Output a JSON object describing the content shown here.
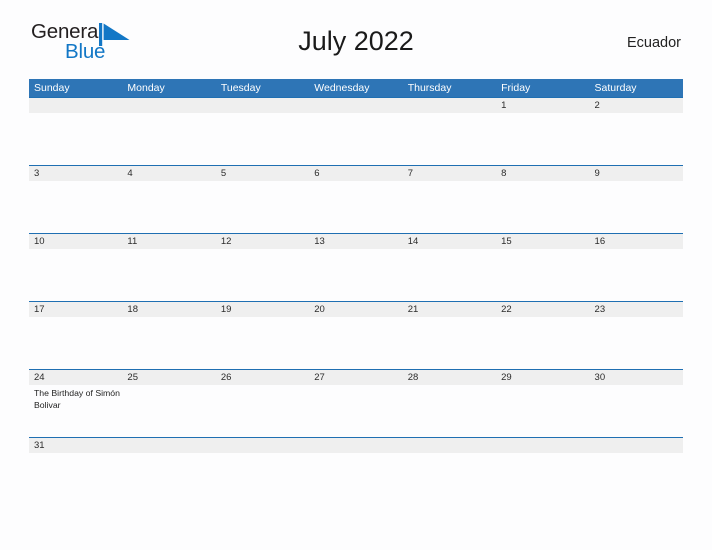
{
  "brand": {
    "name_part1": "General",
    "name_part2": "Blue",
    "flag_color": "#1277c6",
    "text_color": "#231f20"
  },
  "header": {
    "title": "July 2022",
    "locale": "Ecuador"
  },
  "theme": {
    "header_blue": "#2e75b6",
    "rule_blue": "#1f6fb2",
    "band_gray": "#efefef",
    "page_background": "#fdfdfe"
  },
  "calendar": {
    "weekdays": [
      "Sunday",
      "Monday",
      "Tuesday",
      "Wednesday",
      "Thursday",
      "Friday",
      "Saturday"
    ],
    "weeks": [
      {
        "days": [
          {
            "num": "",
            "event": ""
          },
          {
            "num": "",
            "event": ""
          },
          {
            "num": "",
            "event": ""
          },
          {
            "num": "",
            "event": ""
          },
          {
            "num": "",
            "event": ""
          },
          {
            "num": "1",
            "event": ""
          },
          {
            "num": "2",
            "event": ""
          }
        ]
      },
      {
        "days": [
          {
            "num": "3",
            "event": ""
          },
          {
            "num": "4",
            "event": ""
          },
          {
            "num": "5",
            "event": ""
          },
          {
            "num": "6",
            "event": ""
          },
          {
            "num": "7",
            "event": ""
          },
          {
            "num": "8",
            "event": ""
          },
          {
            "num": "9",
            "event": ""
          }
        ]
      },
      {
        "days": [
          {
            "num": "10",
            "event": ""
          },
          {
            "num": "11",
            "event": ""
          },
          {
            "num": "12",
            "event": ""
          },
          {
            "num": "13",
            "event": ""
          },
          {
            "num": "14",
            "event": ""
          },
          {
            "num": "15",
            "event": ""
          },
          {
            "num": "16",
            "event": ""
          }
        ]
      },
      {
        "days": [
          {
            "num": "17",
            "event": ""
          },
          {
            "num": "18",
            "event": ""
          },
          {
            "num": "19",
            "event": ""
          },
          {
            "num": "20",
            "event": ""
          },
          {
            "num": "21",
            "event": ""
          },
          {
            "num": "22",
            "event": ""
          },
          {
            "num": "23",
            "event": ""
          }
        ]
      },
      {
        "days": [
          {
            "num": "24",
            "event": "The Birthday of Simón Bolivar"
          },
          {
            "num": "25",
            "event": ""
          },
          {
            "num": "26",
            "event": ""
          },
          {
            "num": "27",
            "event": ""
          },
          {
            "num": "28",
            "event": ""
          },
          {
            "num": "29",
            "event": ""
          },
          {
            "num": "30",
            "event": ""
          }
        ]
      },
      {
        "short": true,
        "days": [
          {
            "num": "31",
            "event": ""
          },
          {
            "num": "",
            "event": ""
          },
          {
            "num": "",
            "event": ""
          },
          {
            "num": "",
            "event": ""
          },
          {
            "num": "",
            "event": ""
          },
          {
            "num": "",
            "event": ""
          },
          {
            "num": "",
            "event": ""
          }
        ]
      }
    ]
  }
}
